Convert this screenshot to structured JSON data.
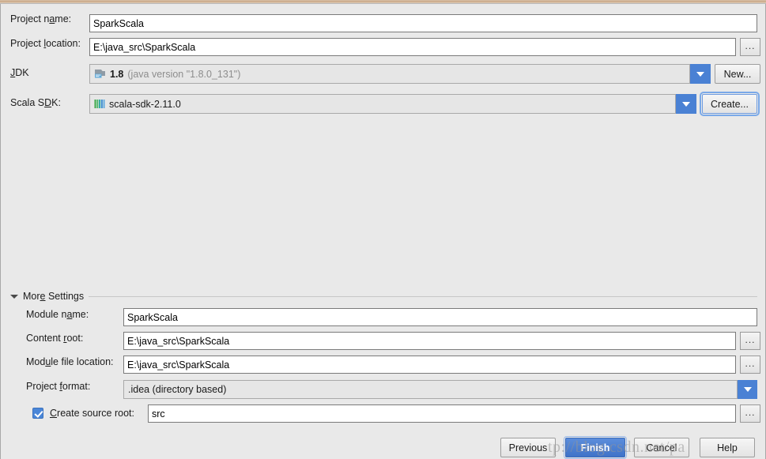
{
  "dialog": {
    "background_color": "#e9e9e9",
    "accent_color": "#4a81d4"
  },
  "top_form": {
    "project_name": {
      "label": "Project name:",
      "value": "SparkScala"
    },
    "project_location": {
      "label": "Project location:",
      "value": "E:\\java_src\\SparkScala",
      "browse_label": "..."
    },
    "jdk": {
      "label": "JDK",
      "value_bold": "1.8",
      "value_muted": "(java version \"1.8.0_131\")",
      "icon": "jdk-icon",
      "new_button_label": "New..."
    },
    "scala_sdk": {
      "label": "Scala SDK:",
      "value": "scala-sdk-2.11.0",
      "icon": "scala-icon",
      "create_button_label": "Create..."
    }
  },
  "more_settings": {
    "header_label": "More Settings",
    "expanded": true,
    "module_name": {
      "label": "Module name:",
      "value": "SparkScala"
    },
    "content_root": {
      "label": "Content root:",
      "value": "E:\\java_src\\SparkScala",
      "browse_label": "..."
    },
    "module_file_location": {
      "label": "Module file location:",
      "value": "E:\\java_src\\SparkScala",
      "browse_label": "..."
    },
    "project_format": {
      "label": "Project format:",
      "value": ".idea (directory based)"
    },
    "create_source_root": {
      "label": "Create source root:",
      "checked": true,
      "value": "src",
      "browse_label": "..."
    }
  },
  "footer": {
    "previous_label": "Previous",
    "finish_label": "Finish",
    "cancel_label": "Cancel",
    "help_label": "Help"
  },
  "watermark": {
    "text": "tp://blog.csdn.net/pa"
  }
}
